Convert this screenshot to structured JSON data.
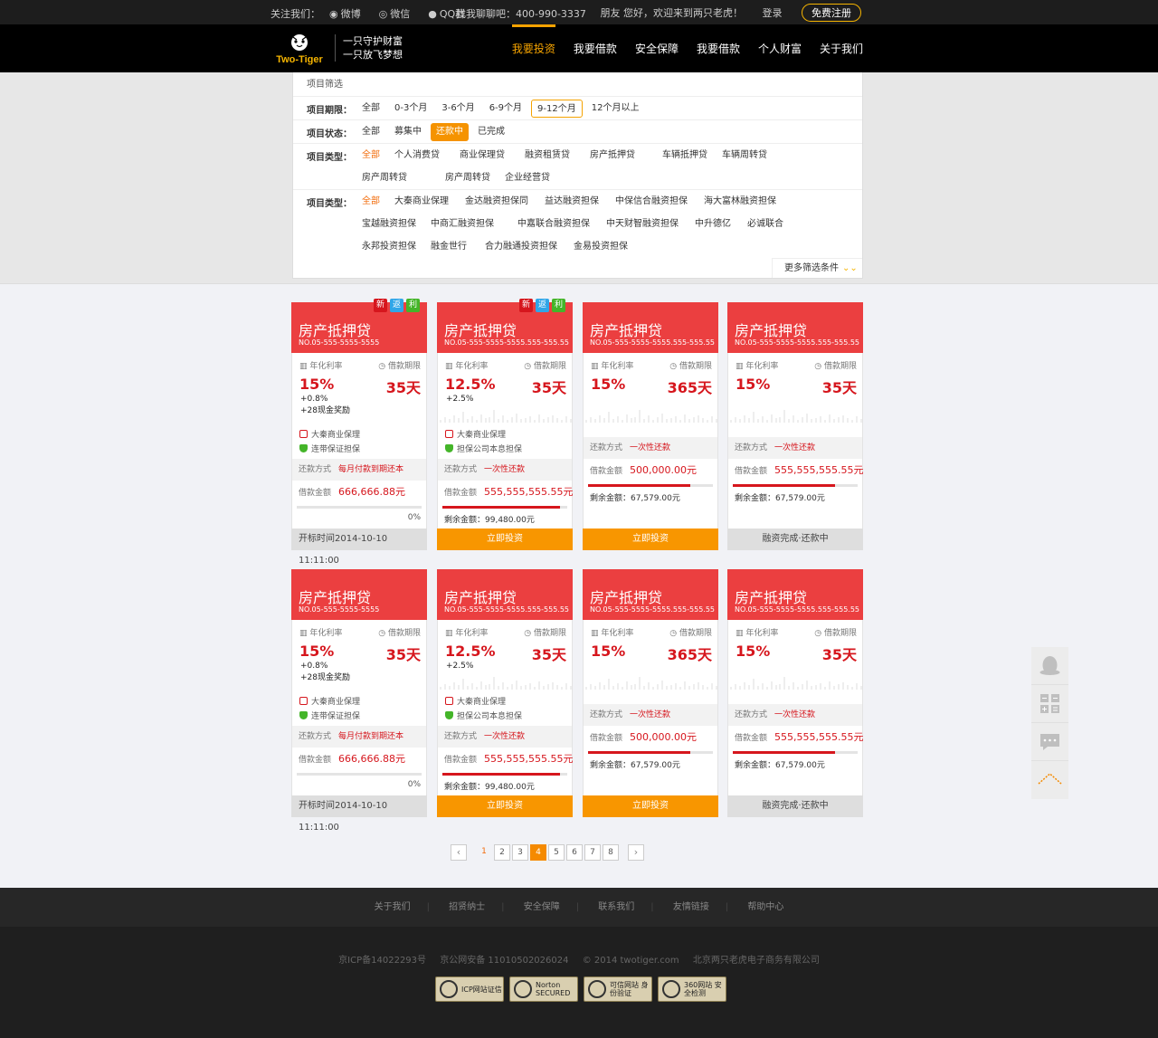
{
  "topbar": {
    "follow": "关注我们：",
    "weibo": "微博",
    "weixin": "微信",
    "qq": "QQ群",
    "hotline": "找我聊聊吧：400-990-3337",
    "welcome": "朋友 您好，欢迎来到两只老虎！",
    "login": "登录",
    "register": "免费注册"
  },
  "brand": {
    "logo": "Two-Tiger",
    "slogan1": "一只守护财富",
    "slogan2": "一只放飞梦想"
  },
  "nav": [
    "我要投资",
    "我要借款",
    "安全保障",
    "我要借款",
    "个人财富",
    "关于我们"
  ],
  "filter": {
    "title": "项目筛选",
    "period_label": "项目期限：",
    "periods": [
      "全部",
      "0-3个月",
      "3-6个月",
      "6-9个月",
      "9-12个月",
      "12个月以上"
    ],
    "status_label": "项目状态：",
    "statuses": [
      "全部",
      "募集中",
      "还款中",
      "已完成"
    ],
    "type_label": "项目类型：",
    "types": [
      "全部",
      "个人消费贷",
      "商业保理贷",
      "融资租赁贷",
      "房产抵押贷",
      "车辆抵押贷",
      "车辆周转贷",
      "房产周转贷",
      "房产周转贷",
      "企业经营贷"
    ],
    "type2_label": "项目类型：",
    "types2": [
      "全部",
      "大秦商业保理",
      "金达融资担保同",
      "益达融资担保",
      "中保信合融资担保",
      "海大富林融资担保",
      "宝越融资担保",
      "中商汇融资担保",
      "中嘉联合融资担保",
      "中天财智融资担保",
      "中升德亿",
      "必诚联合",
      "永邦投资担保",
      "融金世行",
      "合力融通投资担保",
      "金易投资担保"
    ],
    "more": "更多筛选条件"
  },
  "card_labels": {
    "rate": "年化利率",
    "period": "借款期限",
    "repay": "还款方式",
    "amount": "借款金额",
    "remain": "剩余金额："
  },
  "cards": [
    {
      "title": "房产抵押贷",
      "no": "NO.05-555-5555-5555",
      "rate": "15%",
      "days": "35天",
      "extra1": "+0.8%",
      "extra2": "+28现金奖励",
      "g1": "大秦商业保理",
      "g2": "连带保证担保",
      "repay": "每月付款到期还本",
      "amount": "666,666.88元",
      "progress": 0,
      "pct": "0%",
      "foot": "开标时间2014-10-10  11:11:00",
      "style": "A",
      "badges": [
        "新",
        "返",
        "利"
      ]
    },
    {
      "title": "房产抵押贷",
      "no": "NO.05-555-5555-5555.555-555.55",
      "rate": "12.5%",
      "days": "35天",
      "extra1": "+2.5%",
      "extra2": "",
      "g1": "大秦商业保理",
      "g2": "担保公司本息担保",
      "repay": "一次性还款",
      "amount": "555,555,555.55元",
      "progress": 0.94,
      "remain": "99,480.00元",
      "foot": "立即投资",
      "style": "B",
      "badges": [
        "新",
        "返",
        "利"
      ]
    },
    {
      "title": "房产抵押贷",
      "no": "NO.05-555-5555-5555.555-555.55",
      "rate": "15%",
      "days": "365天",
      "repay": "一次性还款",
      "amount": "500,000.00元",
      "progress": 0.82,
      "remain": "67,579.00元",
      "foot": "立即投资",
      "style": "C",
      "badges": []
    },
    {
      "title": "房产抵押贷",
      "no": "NO.05-555-5555-5555.555-555.55",
      "rate": "15%",
      "days": "35天",
      "repay": "一次性还款",
      "amount": "555,555,555.55元",
      "progress": 0.82,
      "remain": "67,579.00元",
      "foot": "融资完成·还款中",
      "style": "D",
      "badges": []
    },
    {
      "title": "房产抵押贷",
      "no": "NO.05-555-5555-5555",
      "rate": "15%",
      "days": "35天",
      "extra1": "+0.8%",
      "extra2": "+28现金奖励",
      "g1": "大秦商业保理",
      "g2": "连带保证担保",
      "repay": "每月付款到期还本",
      "amount": "666,666.88元",
      "progress": 0,
      "pct": "0%",
      "foot": "开标时间2014-10-10  11:11:00",
      "style": "A",
      "badges": []
    },
    {
      "title": "房产抵押贷",
      "no": "NO.05-555-5555-5555.555-555.55",
      "rate": "12.5%",
      "days": "35天",
      "extra1": "+2.5%",
      "extra2": "",
      "g1": "大秦商业保理",
      "g2": "担保公司本息担保",
      "repay": "一次性还款",
      "amount": "555,555,555.55元",
      "progress": 0.94,
      "remain": "99,480.00元",
      "foot": "立即投资",
      "style": "B",
      "badges": []
    },
    {
      "title": "房产抵押贷",
      "no": "NO.05-555-5555-5555.555-555.55",
      "rate": "15%",
      "days": "365天",
      "repay": "一次性还款",
      "amount": "500,000.00元",
      "progress": 0.82,
      "remain": "67,579.00元",
      "foot": "立即投资",
      "style": "C",
      "badges": []
    },
    {
      "title": "房产抵押贷",
      "no": "NO.05-555-5555-5555.555-555.55",
      "rate": "15%",
      "days": "35天",
      "repay": "一次性还款",
      "amount": "555,555,555.55元",
      "progress": 0.82,
      "remain": "67,579.00元",
      "foot": "融资完成·还款中",
      "style": "D",
      "badges": []
    }
  ],
  "pager": {
    "pages": [
      "1",
      "2",
      "3",
      "4",
      "5",
      "6",
      "7",
      "8"
    ],
    "current": "4",
    "prev": "‹",
    "next": "›"
  },
  "side_icons": [
    "qq-icon",
    "calculator-icon",
    "message-icon",
    "back-to-top-icon"
  ],
  "footer": {
    "links": [
      "关于我们",
      "招贤纳士",
      "安全保障",
      "联系我们",
      "友情链接",
      "帮助中心"
    ],
    "icp": "京ICP备14022293号",
    "police": "京公网安备 11010502026024",
    "copyright": "© 2014 twotiger.com",
    "company": "北京两只老虎电子商务有限公司",
    "certs": [
      "ICP网站证信",
      "Norton SECURED",
      "可信网站 身份验证",
      "360网站 安全检测"
    ]
  },
  "colors": {
    "accent": "#f5a300",
    "card_red": "#eb3f40",
    "orange_btn": "#f89600"
  }
}
